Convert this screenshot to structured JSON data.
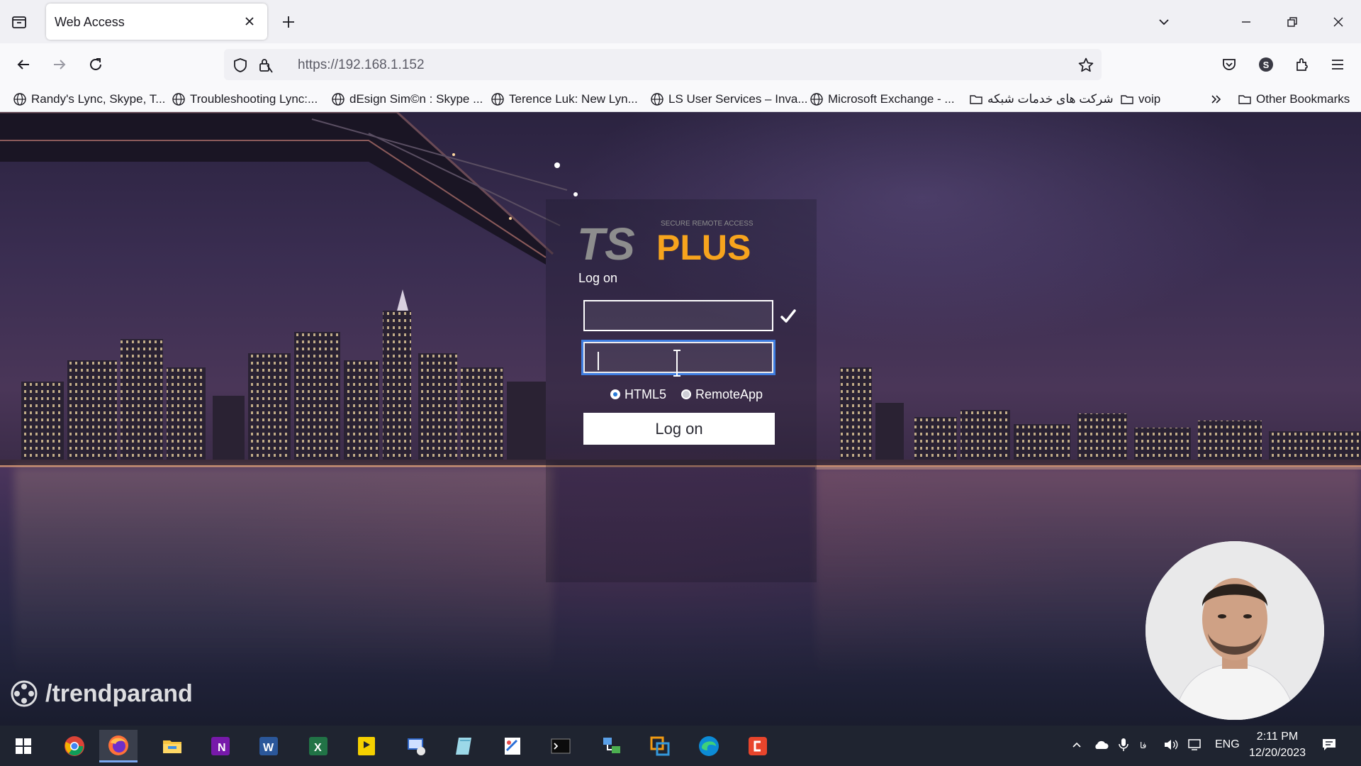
{
  "browser": {
    "tab_title": "Web Access",
    "url": "https://192.168.1.152"
  },
  "bookmarks": [
    {
      "label": "Randy's Lync, Skype, T...",
      "type": "site"
    },
    {
      "label": "Troubleshooting Lync:...",
      "type": "site"
    },
    {
      "label": "dEsign Sim©n : Skype ...",
      "type": "site"
    },
    {
      "label": "Terence Luk: New Lyn...",
      "type": "site"
    },
    {
      "label": "LS User Services – Inva...",
      "type": "site"
    },
    {
      "label": "Microsoft Exchange - ...",
      "type": "site"
    },
    {
      "label": "شرکت های خدمات شبکه",
      "type": "folder"
    },
    {
      "label": "voip",
      "type": "folder"
    }
  ],
  "bookmarks_other": "Other Bookmarks",
  "login": {
    "logo_text": "TSPLUS",
    "logo_tagline": "SECURE REMOTE ACCESS",
    "title": "Log on",
    "username_value": "",
    "password_value": "",
    "mode_options": [
      "HTML5",
      "RemoteApp"
    ],
    "mode_selected": "HTML5",
    "submit_label": "Log on"
  },
  "watermark": "/trendparand",
  "taskbar": {
    "apps": [
      "start-icon",
      "chrome-icon",
      "firefox-icon",
      "file-explorer-icon",
      "onenote-icon",
      "word-icon",
      "excel-icon",
      "player-icon",
      "remote-desktop-icon",
      "notepad-icon",
      "paint-icon",
      "terminal-icon",
      "network-icon",
      "vmware-icon",
      "edge-icon",
      "camtasia-icon"
    ],
    "active_app": "firefox-icon",
    "language": "ENG",
    "time": "2:11 PM",
    "date": "12/20/2023"
  },
  "colors": {
    "accent_blue": "#3f7de0",
    "logo_orange": "#f7a41d",
    "logo_gray": "#8a8a8a",
    "taskbar": "#1f2430"
  }
}
